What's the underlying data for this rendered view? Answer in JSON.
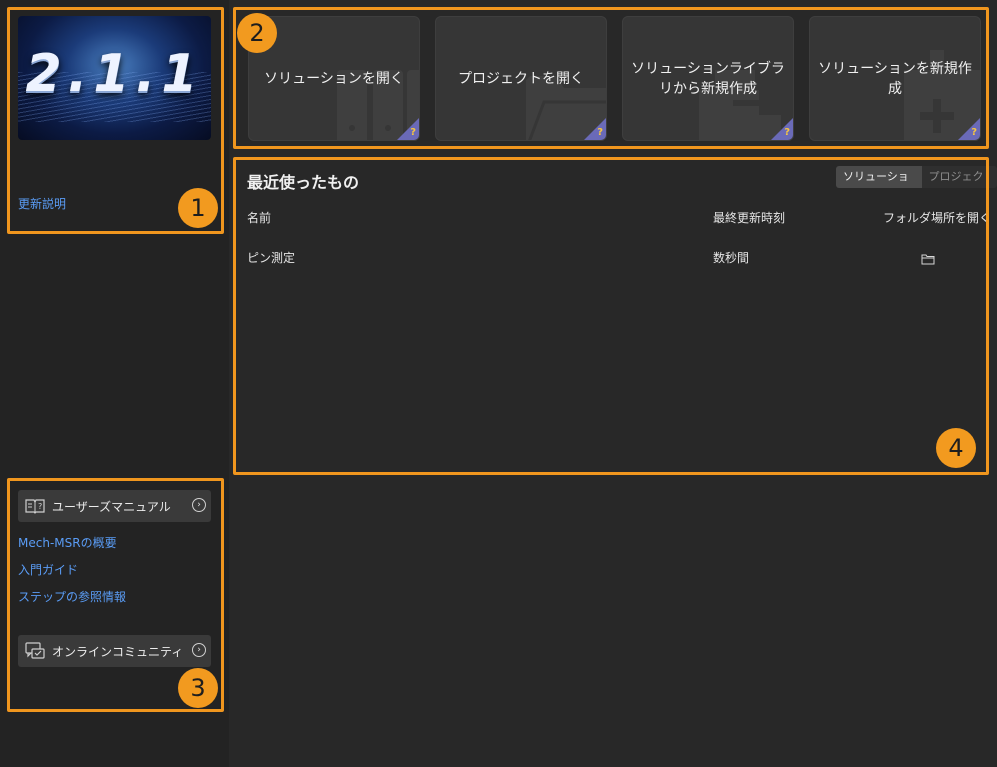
{
  "sidebar": {
    "version_image_text": "2.1.1",
    "release_notes_link": "更新説明",
    "user_manual_button": "ユーザーズマニュアル",
    "links": [
      "Mech-MSRの概要",
      "入門ガイド",
      "ステップの参照情報"
    ],
    "community_button": "オンラインコミュニティ"
  },
  "actions": {
    "cards": [
      {
        "label": "ソリューションを開く",
        "icon": "cabinet-icon"
      },
      {
        "label": "プロジェクトを開く",
        "icon": "folder-icon"
      },
      {
        "label": "ソリューションライブラリから新規作成",
        "icon": "library-icon"
      },
      {
        "label": "ソリューションを新規作成",
        "icon": "new-file-icon"
      }
    ],
    "help_glyph": "?"
  },
  "recent": {
    "title": "最近使ったもの",
    "tabs": [
      "ソリューション",
      "プロジェクト"
    ],
    "active_tab": "ソリューション",
    "columns": {
      "name": "名前",
      "modified": "最終更新時刻",
      "open_folder": "フォルダ場所を開く"
    },
    "rows": [
      {
        "name": "ピン測定",
        "modified": "数秒間"
      }
    ]
  },
  "annotations": [
    "1",
    "2",
    "3",
    "4"
  ],
  "colors": {
    "accent_link": "#5a9cf5",
    "highlight": "#f0961e",
    "badge": "#f29a1f",
    "help_corner": "#6a6ab8"
  }
}
